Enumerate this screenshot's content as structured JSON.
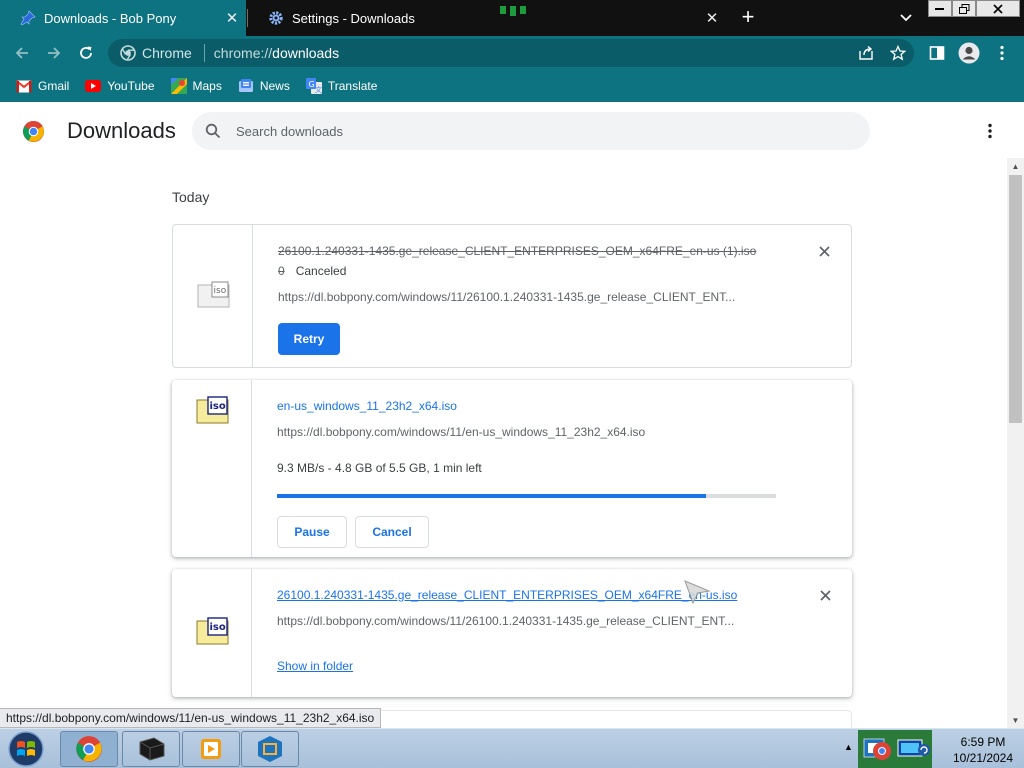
{
  "browser": {
    "tabs": [
      {
        "title": "Downloads - Bob Pony",
        "icon": "pin-icon",
        "active": true
      },
      {
        "title": "Settings - Downloads",
        "icon": "gear-icon",
        "active": false
      }
    ],
    "omnibox": {
      "chip_label": "Chrome",
      "url_scheme": "chrome://",
      "url_host": "downloads"
    },
    "bookmarks": [
      {
        "label": "Gmail",
        "icon": "gmail-icon"
      },
      {
        "label": "YouTube",
        "icon": "youtube-icon"
      },
      {
        "label": "Maps",
        "icon": "maps-icon"
      },
      {
        "label": "News",
        "icon": "news-icon"
      },
      {
        "label": "Translate",
        "icon": "translate-icon"
      }
    ],
    "colors": {
      "theme": "#0e7380",
      "accent": "#1a73e8"
    }
  },
  "downloads": {
    "title": "Downloads",
    "search_placeholder": "Search downloads",
    "section": "Today",
    "items": [
      {
        "filename": "26100.1.240331-1435.ge_release_CLIENT_ENTERPRISES_OEM_x64FRE_en-us (1).iso",
        "status_prefix": "0",
        "status": "Canceled",
        "url": "https://dl.bobpony.com/windows/11/26100.1.240331-1435.ge_release_CLIENT_ENT...",
        "action": "Retry",
        "state": "canceled"
      },
      {
        "filename": "en-us_windows_11_23h2_x64.iso",
        "url": "https://dl.bobpony.com/windows/11/en-us_windows_11_23h2_x64.iso",
        "progress_text": "9.3 MB/s - 4.8 GB of 5.5 GB, 1 min left",
        "progress_fraction": 0.86,
        "actions": [
          "Pause",
          "Cancel"
        ],
        "state": "in_progress"
      },
      {
        "filename": "26100.1.240331-1435.ge_release_CLIENT_ENTERPRISES_OEM_x64FRE_en-us.iso",
        "url": "https://dl.bobpony.com/windows/11/26100.1.240331-1435.ge_release_CLIENT_ENT...",
        "action": "Show in folder",
        "state": "complete"
      }
    ]
  },
  "status_bubble": "https://dl.bobpony.com/windows/11/en-us_windows_11_23h2_x64.iso",
  "taskbar": {
    "apps": [
      "chrome-icon",
      "terminal-icon",
      "media-player-icon",
      "virtualbox-icon"
    ],
    "clock_time": "6:59 PM",
    "clock_date": "10/21/2024"
  }
}
